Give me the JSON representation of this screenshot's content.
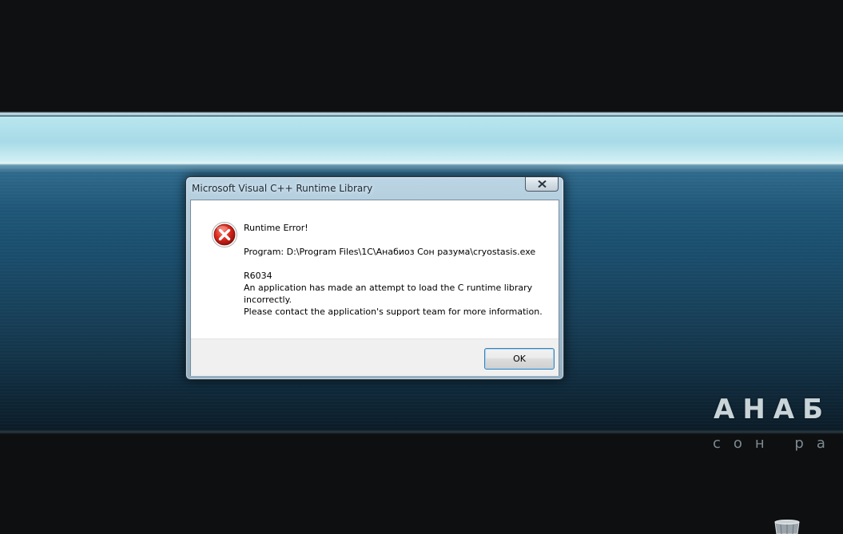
{
  "wallpaper": {
    "logo_text": "АНАБ",
    "logo_subtext": "сон ра"
  },
  "dialog": {
    "title": "Microsoft Visual C++ Runtime Library",
    "close_icon": "close-x-icon",
    "message_icon": "error-icon",
    "message": {
      "heading": "Runtime Error!",
      "program": "Program: D:\\Program Files\\1C\\Анабиоз Сон разума\\cryostasis.exe",
      "code": "R6034",
      "line1": "An application has made an attempt to load the C runtime library",
      "line2": "incorrectly.",
      "line3": "Please contact the application's support team for more information."
    },
    "ok_label": "OK"
  },
  "desktop": {
    "trash_icon": "recycle-bin-icon"
  }
}
